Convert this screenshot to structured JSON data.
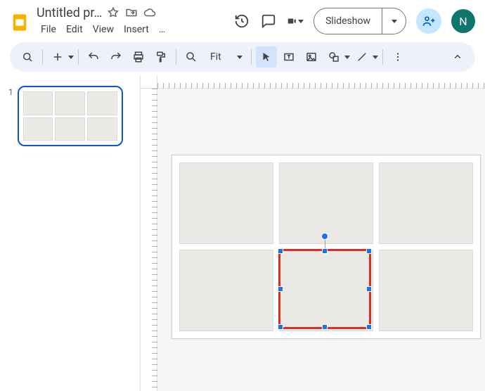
{
  "header": {
    "doc_title": "Untitled pr…",
    "avatar_initial": "N"
  },
  "menu": {
    "file": "File",
    "edit": "Edit",
    "view": "View",
    "insert": "Insert",
    "more": "…"
  },
  "slideshow": {
    "label": "Slideshow"
  },
  "toolbar": {
    "zoom_label": "Fit"
  },
  "thumbs": {
    "slide_1_number": "1"
  },
  "icons": {
    "star": "star-icon",
    "move": "move-folder-icon",
    "cloud": "cloud-saved-icon",
    "history": "history-icon",
    "comment": "comment-icon",
    "meet": "video-meet-icon",
    "share": "person-add-icon",
    "search": "search-icon",
    "plus": "plus-icon",
    "undo": "undo-icon",
    "redo": "redo-icon",
    "print": "print-icon",
    "paint": "paint-format-icon",
    "zoom": "zoom-icon",
    "select": "select-tool-icon",
    "textbox": "textbox-tool-icon",
    "image": "image-tool-icon",
    "shape": "shape-tool-icon",
    "line": "line-tool-icon",
    "more_tools": "more-vert-icon",
    "collapse": "chevron-up-icon"
  }
}
